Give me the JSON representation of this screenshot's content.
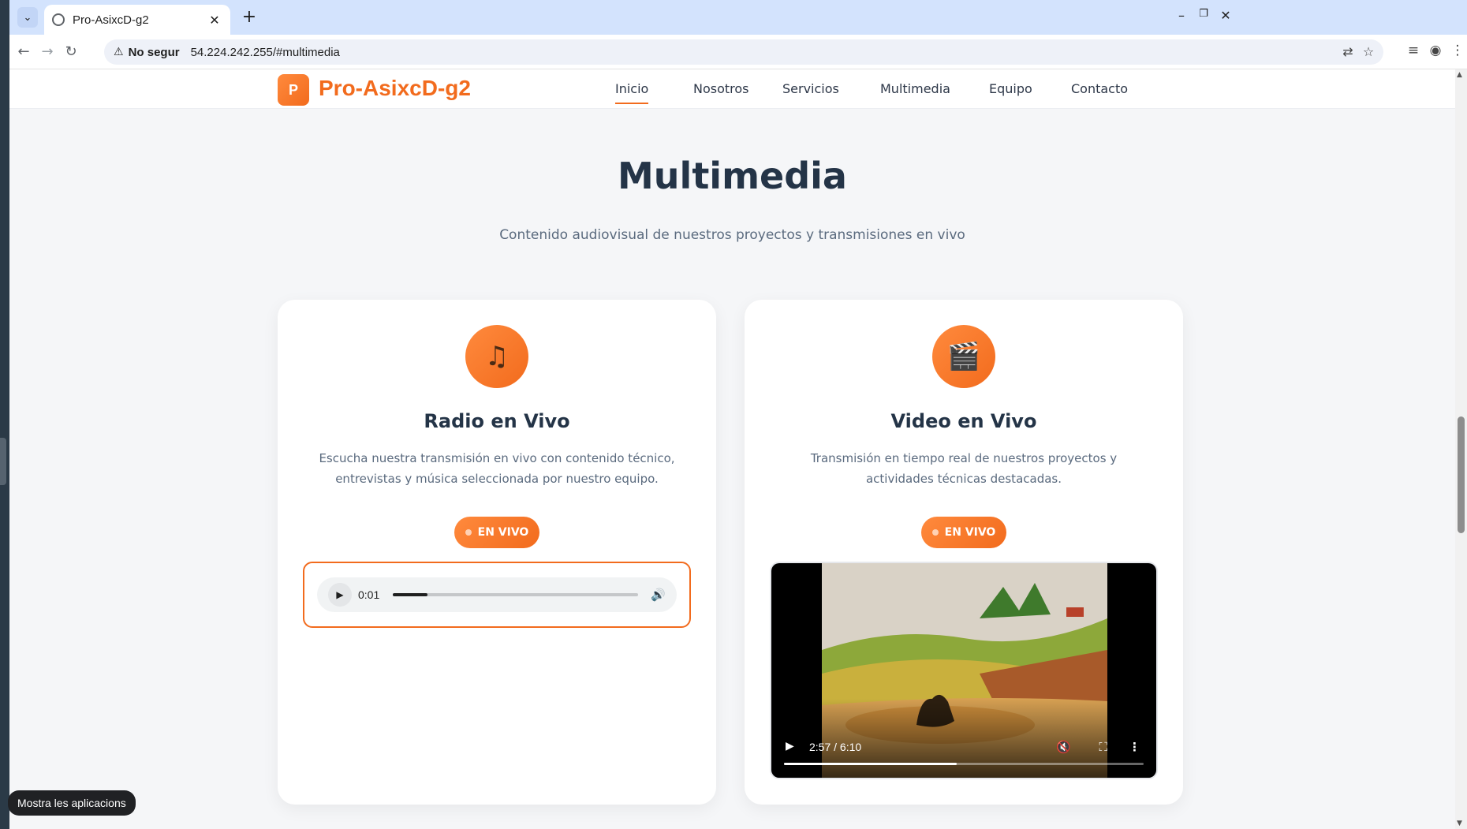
{
  "browser": {
    "tab_title": "Pro-AsixcD-g2",
    "new_tab_label": "+",
    "security_label": "No segur",
    "url": "54.224.242.255/#multimedia"
  },
  "site": {
    "logo_letter": "P",
    "logo_text": "Pro-AsixcD-g2",
    "nav": [
      "Inicio",
      "Nosotros",
      "Servicios",
      "Multimedia",
      "Equipo",
      "Contacto"
    ],
    "active_nav": "Inicio"
  },
  "section": {
    "title": "Multimedia",
    "subtitle": "Contenido audiovisual de nuestros proyectos y transmisiones en vivo"
  },
  "cards": [
    {
      "icon": "music-note-icon",
      "title": "Radio en Vivo",
      "description": "Escucha nuestra transmisión en vivo con contenido técnico, entrevistas y música seleccionada por nuestro equipo.",
      "badge": "EN VIVO",
      "player": {
        "type": "audio",
        "time": "0:01",
        "progress": 0.14
      }
    },
    {
      "icon": "clapperboard-icon",
      "title": "Video en Vivo",
      "description": "Transmisión en tiempo real de nuestros proyectos y actividades técnicas destacadas.",
      "badge": "EN VIVO",
      "player": {
        "type": "video",
        "time": "2:57 / 6:10",
        "progress": 0.48
      }
    }
  ],
  "tooltip": "Mostra les aplicacions",
  "colors": {
    "accent": "#f26b1d",
    "heading": "#243447",
    "text": "#5a6a7e"
  }
}
